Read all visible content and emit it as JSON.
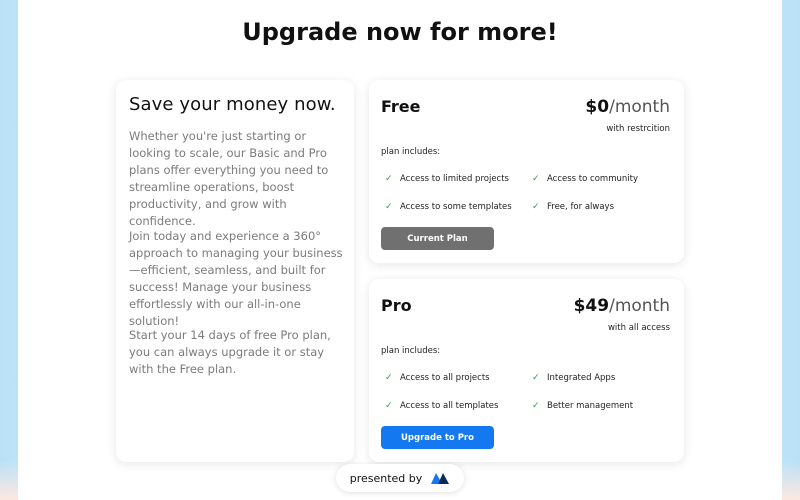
{
  "headline": "Upgrade now for more!",
  "info": {
    "title": "Save your money now.",
    "paragraph1": "Whether you're just starting or looking to scale, our Basic and Pro plans offer everything you need to streamline operations, boost productivity, and grow with confidence.",
    "paragraph2": "Join today and experience a 360° approach to managing your business—efficient, seamless, and built for success! Manage your business effortlessly with our all-in-one solution!",
    "paragraph3": "Start your 14 days of free Pro plan, you can always upgrade it or stay with the Free plan."
  },
  "plans": [
    {
      "name": "Free",
      "price": "$0",
      "period": "/month",
      "subtitle": "with restrcition",
      "includes_label": "plan includes:",
      "features": [
        "Access to limited projects",
        "Access to community",
        "Access to some templates",
        "Free, for always"
      ],
      "button_label": "Current Plan",
      "button_color": "#707070"
    },
    {
      "name": "Pro",
      "price": "$49",
      "period": "/month",
      "subtitle": "with all access",
      "includes_label": "plan includes:",
      "features": [
        "Access to all projects",
        "Integrated Apps",
        "Access to all templates",
        "Better management"
      ],
      "button_label": "Upgrade to Pro",
      "button_color": "#1478f0"
    }
  ],
  "footer": {
    "presented_by": "presented by",
    "logo_icon": "brand-logo-icon"
  },
  "colors": {
    "accent": "#1478f0",
    "check": "#2c9b53",
    "muted_text": "#7b7b7b"
  }
}
